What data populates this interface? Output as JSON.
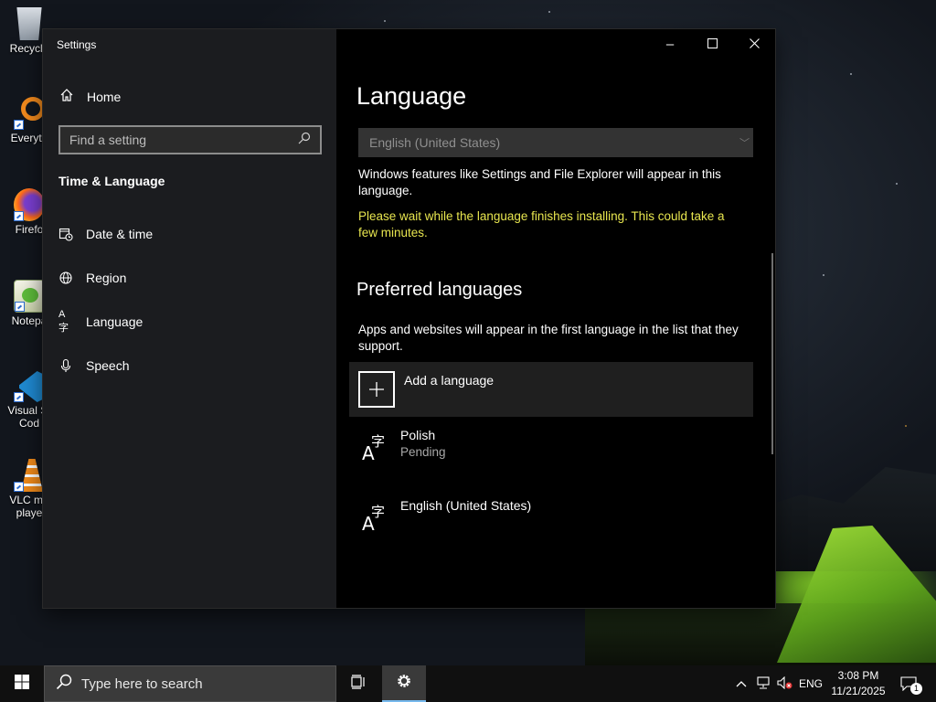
{
  "desktop": {
    "icons": [
      {
        "label": "Recycle",
        "icon": "recycle-bin-icon"
      },
      {
        "label": "Everyth",
        "icon": "everything-search-icon"
      },
      {
        "label": "Firefo",
        "icon": "firefox-icon"
      },
      {
        "label": "Notepa",
        "icon": "notepad-plus-plus-icon"
      },
      {
        "label": "Visual St",
        "label2": "Cod",
        "icon": "vscode-icon"
      },
      {
        "label": "VLC me",
        "label2": "playe",
        "icon": "vlc-icon"
      }
    ]
  },
  "window": {
    "app_title": "Settings",
    "controls": {
      "minimize": "–",
      "maximize": "☐",
      "close": "✕"
    }
  },
  "nav": {
    "home_label": "Home",
    "search_placeholder": "Find a setting",
    "section_title": "Time & Language",
    "items": [
      {
        "label": "Date & time",
        "icon": "calendar-clock-icon"
      },
      {
        "label": "Region",
        "icon": "globe-icon"
      },
      {
        "label": "Language",
        "icon": "language-icon"
      },
      {
        "label": "Speech",
        "icon": "microphone-icon"
      }
    ]
  },
  "content": {
    "page_title": "Language",
    "display_language_value": "English (United States)",
    "display_language_desc": "Windows features like Settings and File Explorer will appear in this language.",
    "install_warning": "Please wait while the language finishes installing. This could take a few minutes.",
    "preferred_title": "Preferred languages",
    "preferred_desc": "Apps and websites will appear in the first language in the list that they support.",
    "add_language_label": "Add a language",
    "languages": [
      {
        "name": "Polish",
        "status": "Pending"
      },
      {
        "name": "English (United States)",
        "status": ""
      }
    ]
  },
  "taskbar": {
    "search_placeholder": "Type here to search",
    "tray": {
      "language": "ENG",
      "time": "3:08 PM",
      "date": "11/21/2025",
      "notification_count": "1"
    }
  },
  "colors": {
    "warning_text": "#e8e64f",
    "taskbar_active_underline": "#76b9ed"
  }
}
